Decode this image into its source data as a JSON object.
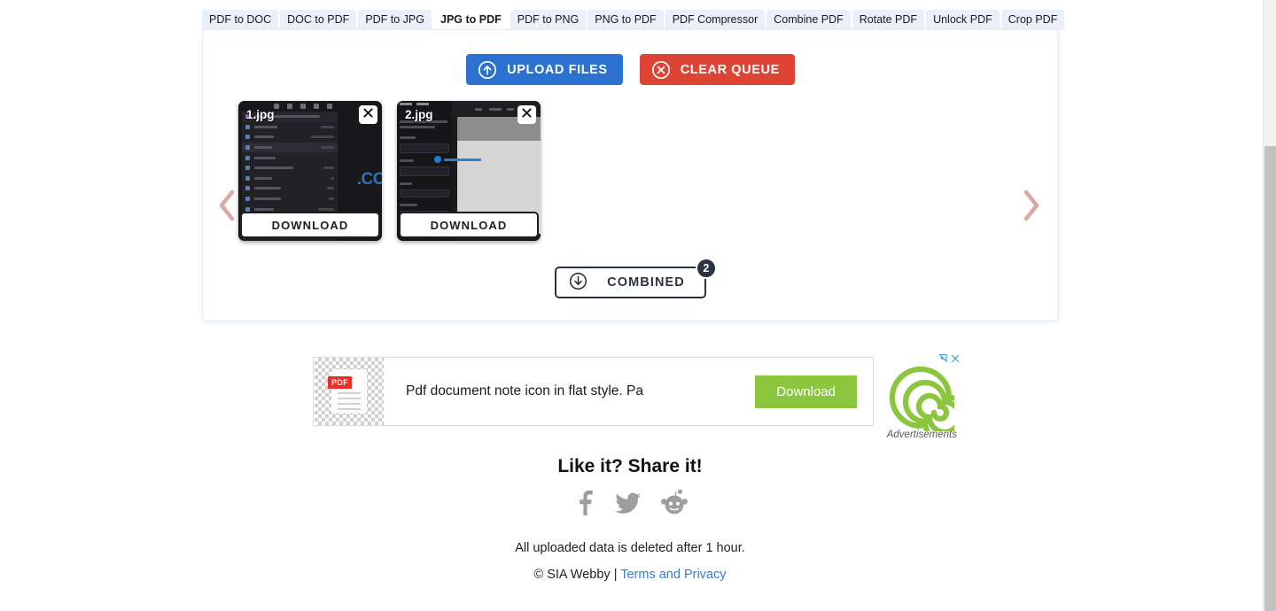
{
  "tabs": [
    {
      "label": "PDF to DOC",
      "active": false
    },
    {
      "label": "DOC to PDF",
      "active": false
    },
    {
      "label": "PDF to JPG",
      "active": false
    },
    {
      "label": "JPG to PDF",
      "active": true
    },
    {
      "label": "PDF to PNG",
      "active": false
    },
    {
      "label": "PNG to PDF",
      "active": false
    },
    {
      "label": "PDF Compressor",
      "active": false
    },
    {
      "label": "Combine PDF",
      "active": false
    },
    {
      "label": "Rotate PDF",
      "active": false
    },
    {
      "label": "Unlock PDF",
      "active": false
    },
    {
      "label": "Crop PDF",
      "active": false
    }
  ],
  "toolbar": {
    "upload_label": "UPLOAD FILES",
    "clear_label": "CLEAR QUEUE",
    "upload_icon": "upload-circle-icon",
    "clear_icon": "close-circle-icon",
    "upload_color": "#2a71d0",
    "clear_color": "#dd4433"
  },
  "carousel": {
    "prev_icon": "chevron-left-icon",
    "next_icon": "chevron-right-icon",
    "chevron_color": "#dba9a2",
    "files": [
      {
        "name": "1.jpg",
        "download_label": "DOWNLOAD",
        "close_icon": "close-icon"
      },
      {
        "name": "2.jpg",
        "download_label": "DOWNLOAD",
        "close_icon": "close-icon"
      }
    ]
  },
  "combined": {
    "label": "COMBINED",
    "count": "2",
    "icon": "download-circle-icon",
    "color": "#2b3342"
  },
  "ad": {
    "headline": "Pdf document note icon in flat style. Pa",
    "cta_label": "Download",
    "cta_color": "#8cc63f",
    "label": "Advertisements",
    "adchoices_icon": "adchoices-icon",
    "close_icon": "close-x-icon",
    "doc_icon_label": "PDF",
    "logo_icon": "spiral-logo-icon"
  },
  "share": {
    "title": "Like it? Share it!",
    "networks": [
      {
        "name": "facebook-icon"
      },
      {
        "name": "twitter-icon"
      },
      {
        "name": "reddit-icon"
      }
    ]
  },
  "footer": {
    "notice": "All uploaded data is deleted after 1 hour.",
    "copyright": "© SIA Webby | ",
    "link": "Terms and Privacy"
  }
}
